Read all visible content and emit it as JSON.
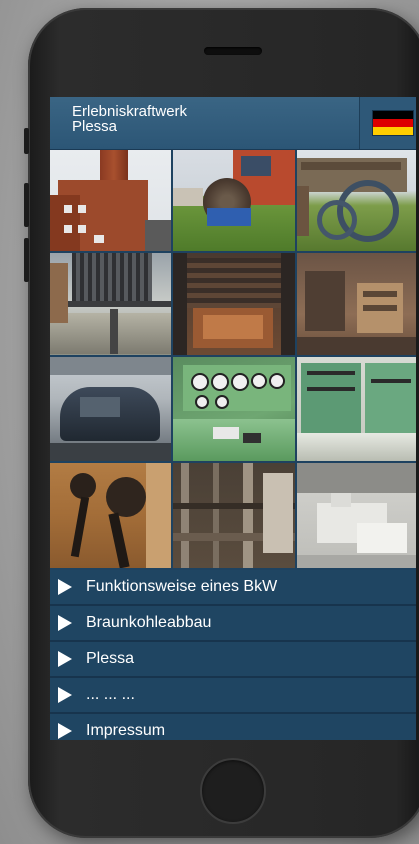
{
  "app": {
    "title_line1": "Erlebniskraftwerk",
    "title_line2": "Plessa"
  },
  "header": {
    "language_flag": "flag-germany-icon",
    "flag_colors": [
      "#000000",
      "#dd0000",
      "#ffce00"
    ]
  },
  "gallery": {
    "tiles": [
      {
        "name": "brick-building-tower-photo"
      },
      {
        "name": "turbine-wheel-outdoor-photo"
      },
      {
        "name": "excavator-machinery-outdoor-photo"
      },
      {
        "name": "boiler-structure-photo"
      },
      {
        "name": "rusty-coal-machinery-photo"
      },
      {
        "name": "rusty-control-mechanism-photo"
      },
      {
        "name": "generator-hall-photo"
      },
      {
        "name": "green-control-panel-gauges-photo"
      },
      {
        "name": "control-room-console-photo"
      },
      {
        "name": "lever-handles-photo"
      },
      {
        "name": "interior-piping-photo"
      },
      {
        "name": "model-building-photo"
      }
    ]
  },
  "menu": {
    "items": [
      {
        "label": "Funktionsweise eines BkW"
      },
      {
        "label": "Braunkohleabbau"
      },
      {
        "label": "Plessa"
      },
      {
        "label": "... ... ..."
      },
      {
        "label": "Impressum"
      }
    ]
  }
}
